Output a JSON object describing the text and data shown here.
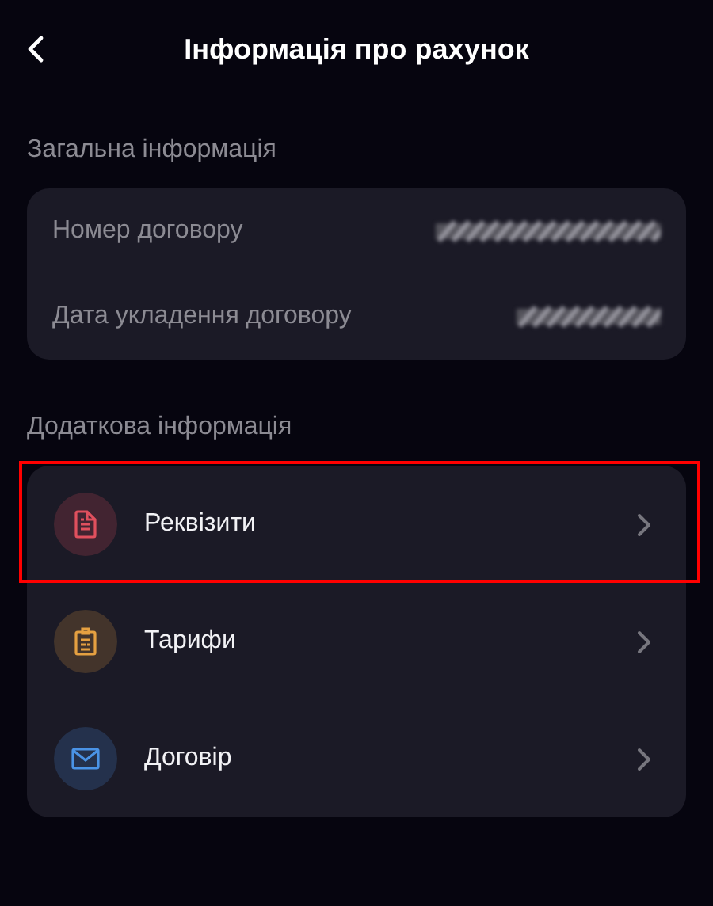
{
  "header": {
    "title": "Інформація про рахунок"
  },
  "general": {
    "heading": "Загальна інформація",
    "rows": [
      {
        "label": "Номер договору",
        "redacted": true
      },
      {
        "label": "Дата укладення договору",
        "redacted": true
      }
    ]
  },
  "additional": {
    "heading": "Додаткова інформація",
    "items": [
      {
        "label": "Реквізити",
        "kind": "document",
        "color": "#e0505e",
        "highlighted": true
      },
      {
        "label": "Тарифи",
        "kind": "clipboard",
        "color": "#e5a041",
        "highlighted": false
      },
      {
        "label": "Договір",
        "kind": "envelope",
        "color": "#4a93e6",
        "highlighted": false
      }
    ]
  }
}
